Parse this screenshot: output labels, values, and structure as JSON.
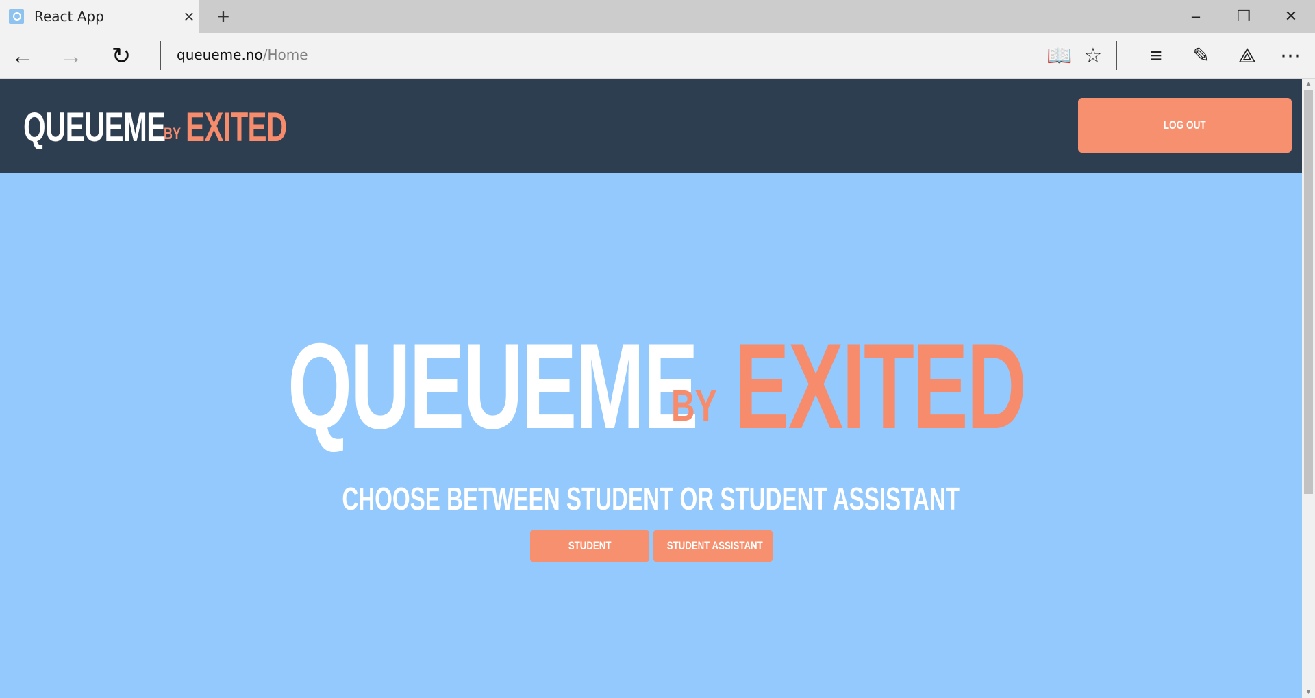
{
  "browser": {
    "tab_title": "React App",
    "address_host": "queueme.no",
    "address_path": "/Home",
    "icons": {
      "favicon": "react-app-favicon",
      "tab_close": "close-icon",
      "new_tab": "plus-icon",
      "minimize": "minimize-icon",
      "restore": "restore-icon",
      "window_close": "close-icon",
      "back": "back-arrow-icon",
      "forward": "forward-arrow-icon",
      "refresh": "refresh-icon",
      "reading_view": "book-icon",
      "favorites": "star-icon",
      "hub": "hub-icon",
      "web_note": "pen-note-icon",
      "share": "share-icon",
      "more": "more-icon"
    }
  },
  "header": {
    "brand_main": "QUEUEME",
    "brand_by": "BY",
    "brand_company": "EXITED",
    "logout_label": "LOG OUT"
  },
  "hero": {
    "title_main": "QUEUEME",
    "title_by": "BY",
    "title_company": "EXITED",
    "subtitle": "CHOOSE BETWEEN STUDENT OR STUDENT ASSISTANT"
  },
  "choices": {
    "student_label": "STUDENT",
    "assistant_label": "STUDENT ASSISTANT"
  },
  "colors": {
    "header_bg": "#2d3e51",
    "page_bg": "#94c9fd",
    "accent": "#f78c6c",
    "text_white": "#ffffff"
  }
}
